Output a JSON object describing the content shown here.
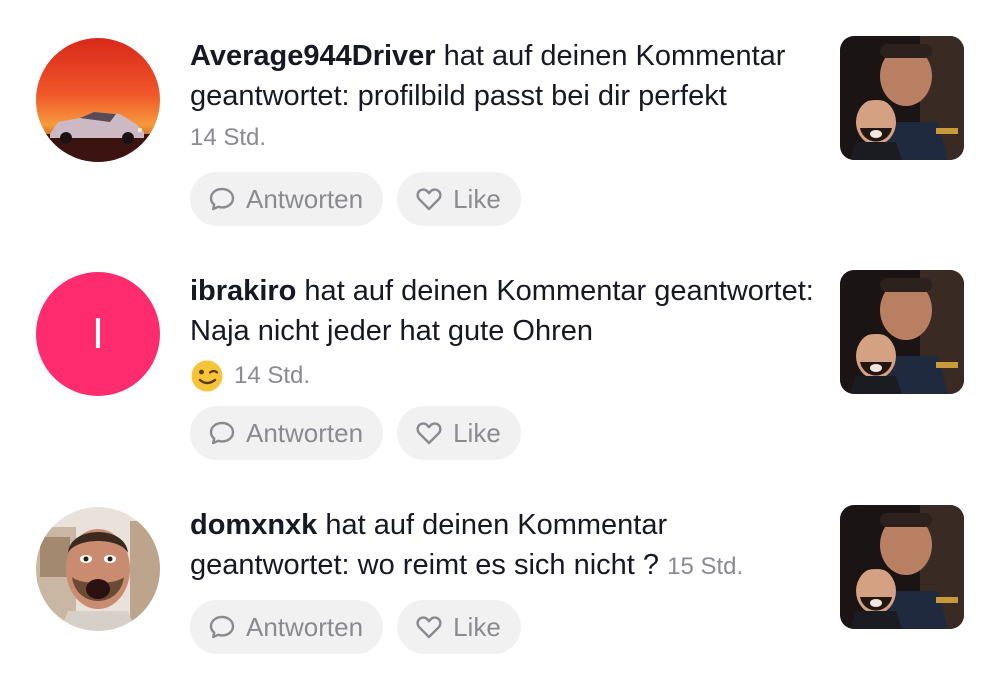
{
  "notifications": [
    {
      "user": "Average944Driver",
      "message": " hat auf deinen Kommentar geantwortet: profilbild passt bei dir perfekt",
      "time": "14 Std.",
      "avatar": "sunset-car-avatar",
      "reply_label": "Antworten",
      "like_label": "Like"
    },
    {
      "user": "ibrakiro",
      "message": " hat auf deinen Kommentar geantwortet: Naja nicht jeder hat gute Ohren",
      "emoji": "winking-face",
      "time": "14 Std.",
      "avatar_letter": "I",
      "reply_label": "Antworten",
      "like_label": "Like"
    },
    {
      "user": "domxnxk",
      "message": " hat auf deinen Kommentar geantwortet: wo reimt es sich nicht ?",
      "time": "15 Std.",
      "avatar": "shouting-man-avatar",
      "reply_label": "Antworten",
      "like_label": "Like"
    }
  ],
  "colors": {
    "letter_avatar_bg": "#fe2c6e",
    "pill_bg": "#f1f1f2",
    "muted_text": "#8a8b91",
    "primary_text": "#161823"
  }
}
